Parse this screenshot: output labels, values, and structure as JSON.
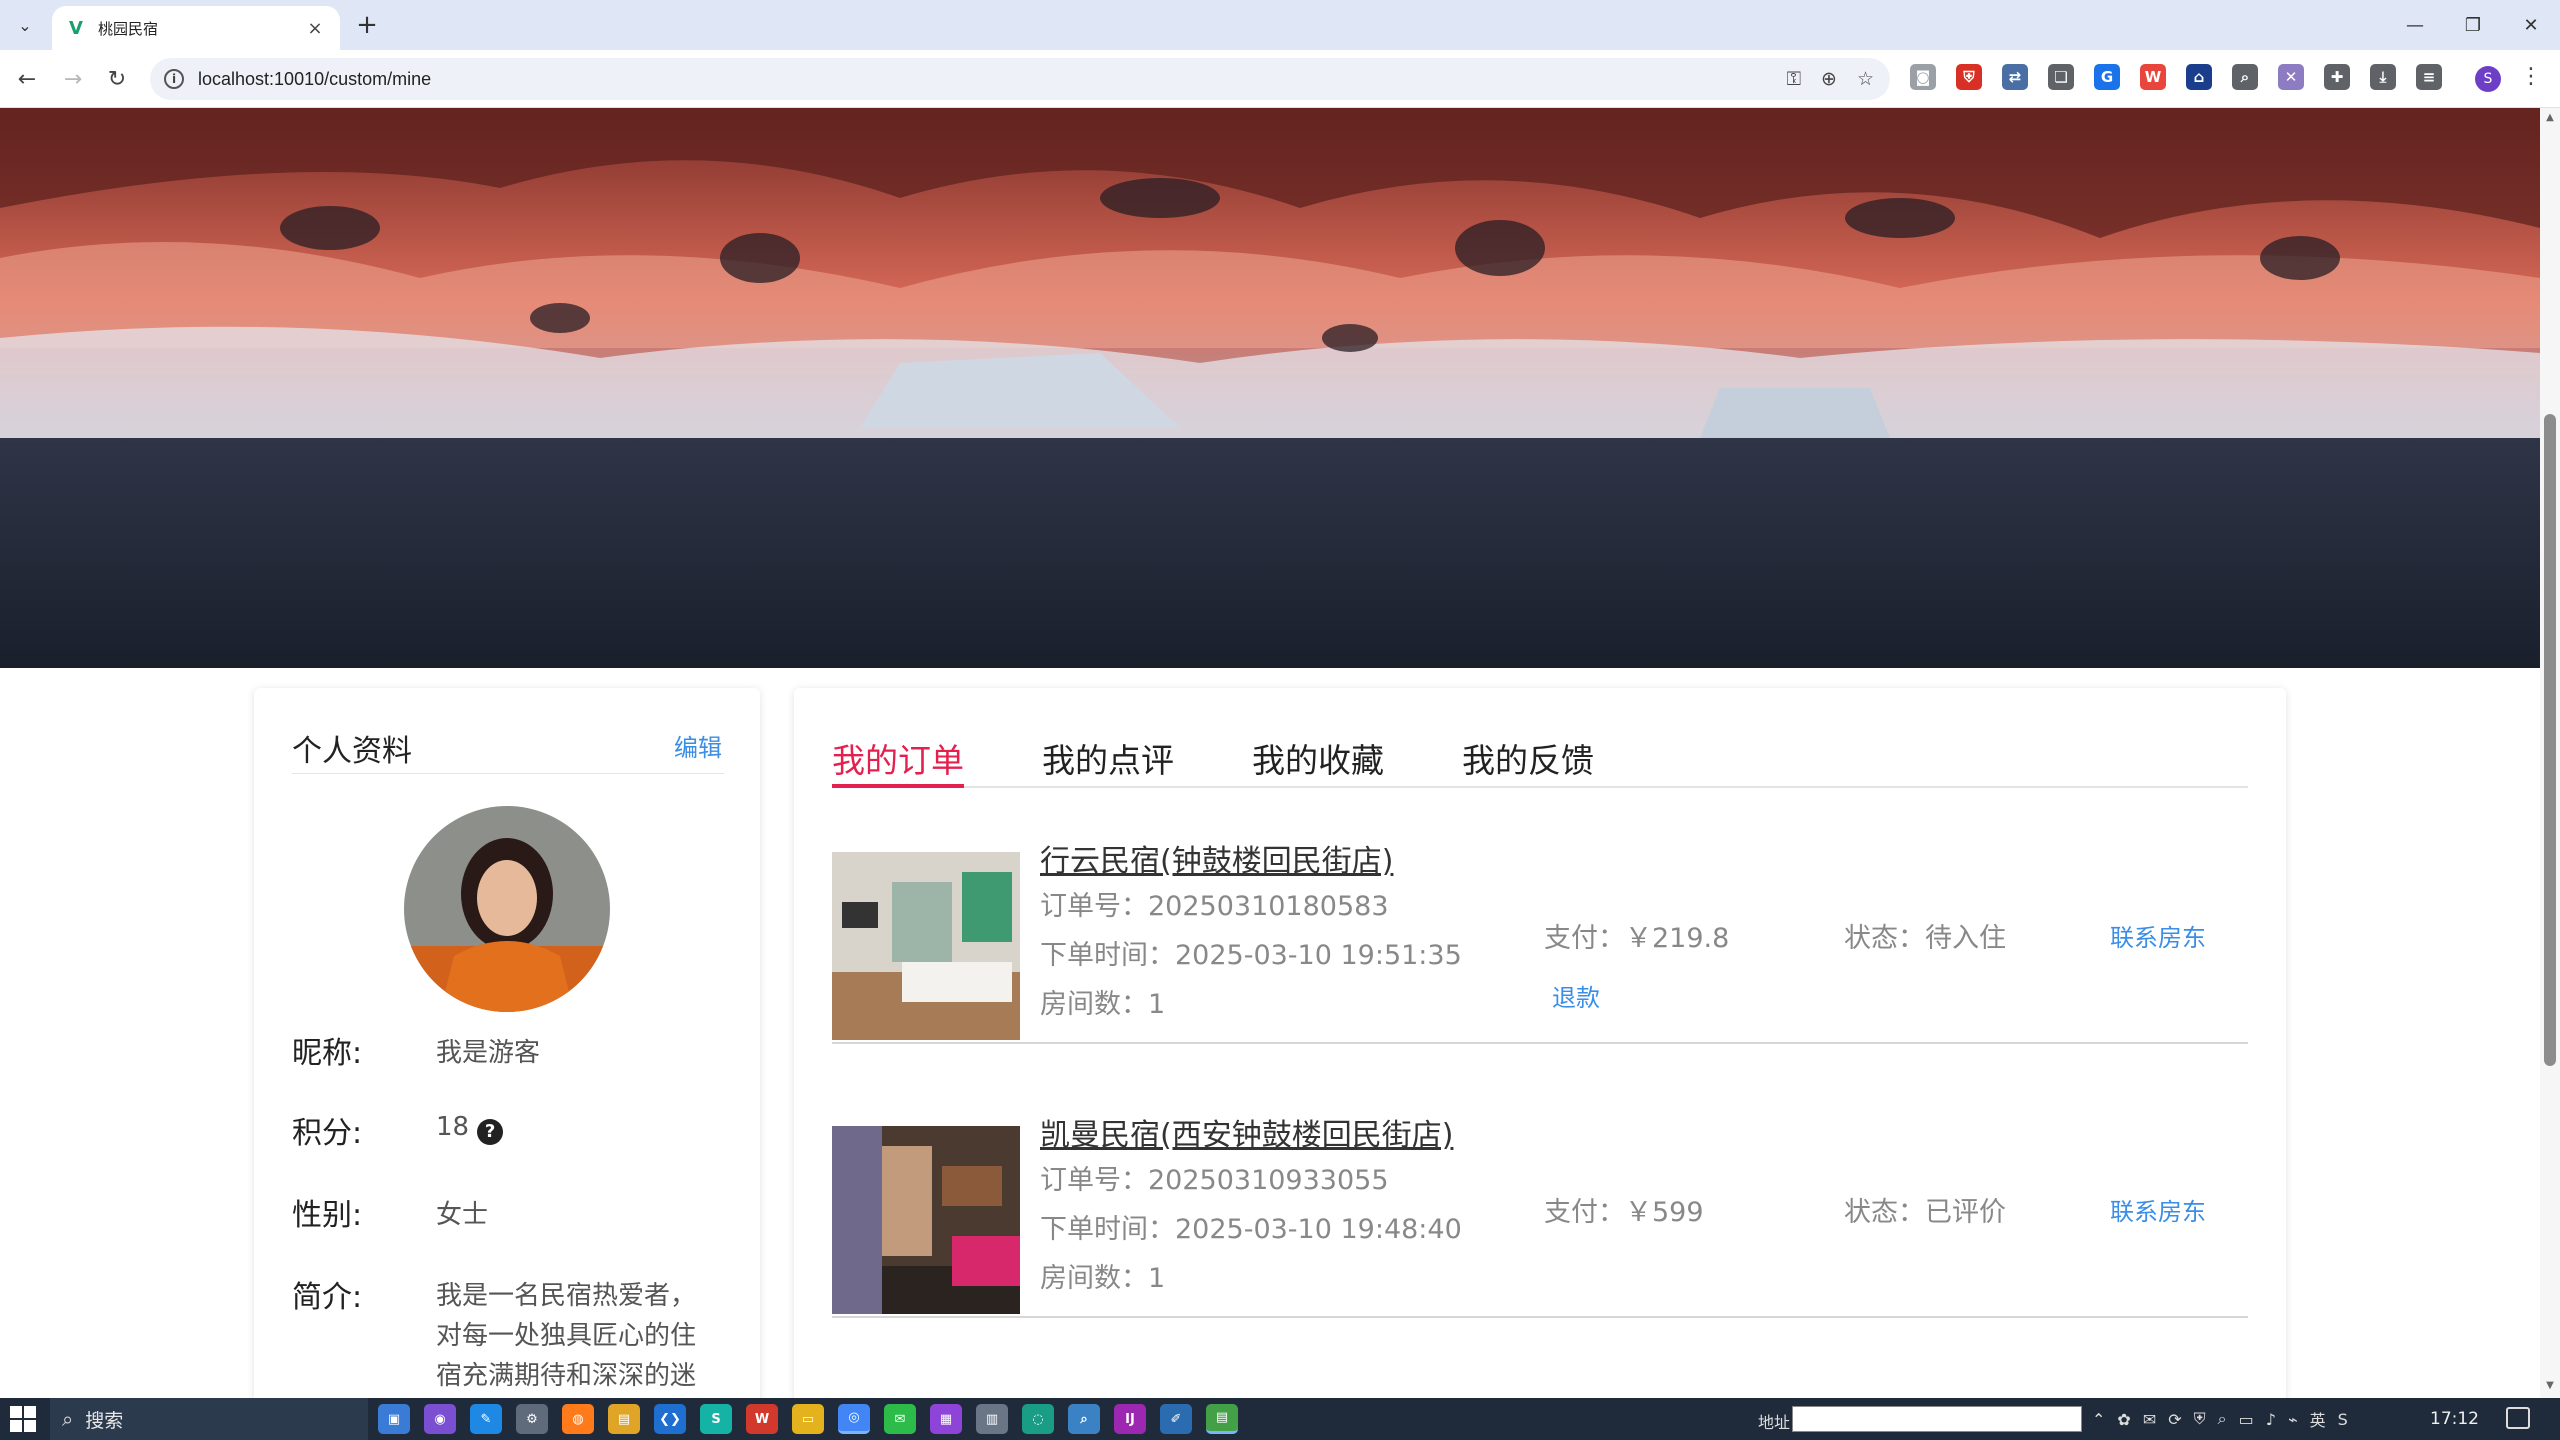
{
  "browser": {
    "tab_title": "桃园民宿",
    "url": "localhost:10010/custom/mine",
    "new_tab": "+",
    "tab_close": "×",
    "profile_initial": "S"
  },
  "profile": {
    "title": "个人资料",
    "edit": "编辑",
    "nickname_label": "昵称:",
    "nickname": "我是游客",
    "points_label": "积分:",
    "points": "18",
    "help": "?",
    "gender_label": "性别:",
    "gender": "女士",
    "bio_label": "简介:",
    "bio": "我是一名民宿热爱者，对每一处独具匠心的住宿充满期待和深深的迷"
  },
  "tabs": [
    {
      "label": "我的订单",
      "active": true
    },
    {
      "label": "我的点评",
      "active": false
    },
    {
      "label": "我的收藏",
      "active": false
    },
    {
      "label": "我的反馈",
      "active": false
    }
  ],
  "orders": [
    {
      "name": "行云民宿(钟鼓楼回民街店)",
      "order_no": "订单号：20250310180583",
      "order_time": "下单时间：2025-03-10 19:51:35",
      "rooms": "房间数：1",
      "pay": "支付：￥219.8",
      "status": "状态：待入住",
      "contact": "联系房东",
      "refund": "退款"
    },
    {
      "name": "凯曼民宿(西安钟鼓楼回民街店)",
      "order_no": "订单号：20250310933055",
      "order_time": "下单时间：2025-03-10 19:48:40",
      "rooms": "房间数：1",
      "pay": "支付：￥599",
      "status": "状态：已评价",
      "contact": "联系房东"
    }
  ],
  "taskbar": {
    "search": "搜索",
    "address_label": "地址",
    "ime": "英",
    "clock": "17:12"
  }
}
